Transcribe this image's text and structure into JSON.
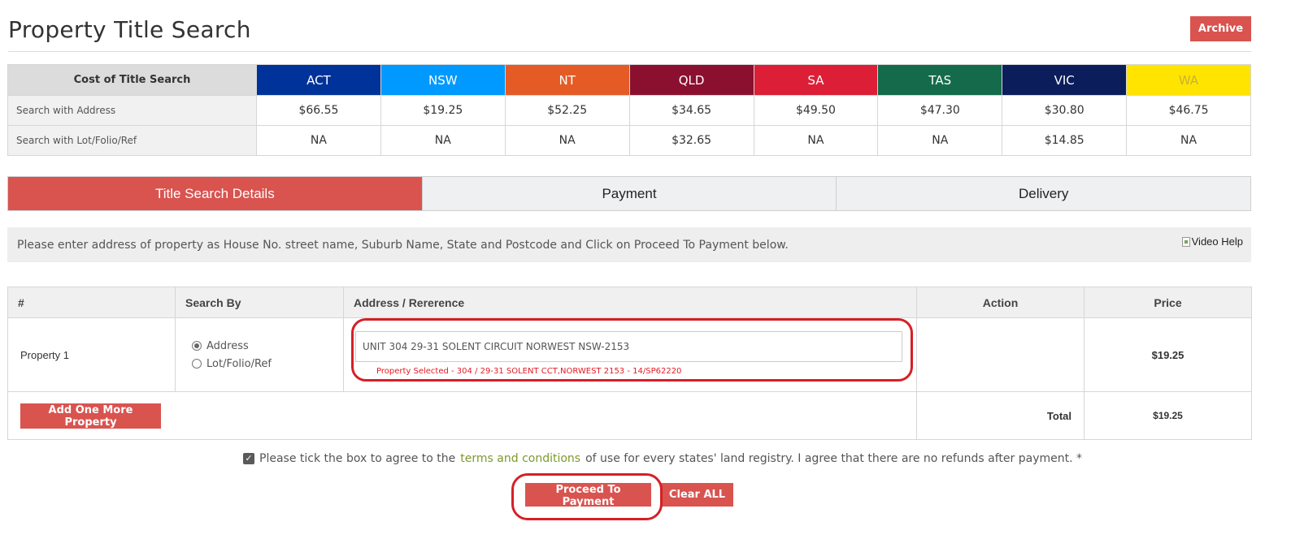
{
  "page": {
    "title": "Property Title Search",
    "archive_label": "Archive"
  },
  "cost_table": {
    "header_label": "Cost of Title Search",
    "states": [
      {
        "code": "ACT",
        "color": "#003399",
        "text_color": "#ffffff"
      },
      {
        "code": "NSW",
        "color": "#0099ff",
        "text_color": "#ffffff"
      },
      {
        "code": "NT",
        "color": "#e55b26",
        "text_color": "#ffffff"
      },
      {
        "code": "QLD",
        "color": "#8b1030",
        "text_color": "#ffffff"
      },
      {
        "code": "SA",
        "color": "#dc1f36",
        "text_color": "#ffffff"
      },
      {
        "code": "TAS",
        "color": "#146b4b",
        "text_color": "#ffffff"
      },
      {
        "code": "VIC",
        "color": "#0b1e5b",
        "text_color": "#ffffff"
      },
      {
        "code": "WA",
        "color": "#ffe400",
        "text_color": "#c9b03a"
      }
    ],
    "rows": [
      {
        "label": "Search with Address",
        "values": [
          "$66.55",
          "$19.25",
          "$52.25",
          "$34.65",
          "$49.50",
          "$47.30",
          "$30.80",
          "$46.75"
        ]
      },
      {
        "label": "Search with Lot/Folio/Ref",
        "values": [
          "NA",
          "NA",
          "NA",
          "$32.65",
          "NA",
          "NA",
          "$14.85",
          "NA"
        ]
      }
    ]
  },
  "tabs": [
    {
      "label": "Title Search Details",
      "active": true
    },
    {
      "label": "Payment",
      "active": false
    },
    {
      "label": "Delivery",
      "active": false
    }
  ],
  "instruction": {
    "text": "Please enter address of property as House No. street name, Suburb Name, State and Postcode and Click on Proceed To Payment below.",
    "video_help": "Video Help"
  },
  "property_table": {
    "headers": {
      "num": "#",
      "search_by": "Search By",
      "address": "Address / Rererence",
      "action": "Action",
      "price": "Price"
    },
    "rows": [
      {
        "label": "Property 1",
        "options": [
          "Address",
          "Lot/Folio/Ref"
        ],
        "selected_option": "Address",
        "address_value": "UNIT 304 29-31 SOLENT CIRCUIT NORWEST NSW-2153",
        "selected_note": "Property Selected - 304 / 29-31 SOLENT CCT,NORWEST 2153    -    14/SP62220",
        "price": "$19.25"
      }
    ],
    "add_button": "Add One More Property",
    "total_label": "Total",
    "total_value": "$19.25"
  },
  "agreement": {
    "checked": true,
    "before": "Please tick the box to agree to the",
    "link": "terms and conditions",
    "after": "of use for every states' land registry. I agree that there are no refunds after payment. *"
  },
  "actions": {
    "proceed": "Proceed To Payment",
    "clear": "Clear ALL"
  },
  "colors": {
    "accent": "#d9534f",
    "highlight": "#d61f26",
    "note": "#e31b23",
    "link": "#7c9a2a"
  }
}
